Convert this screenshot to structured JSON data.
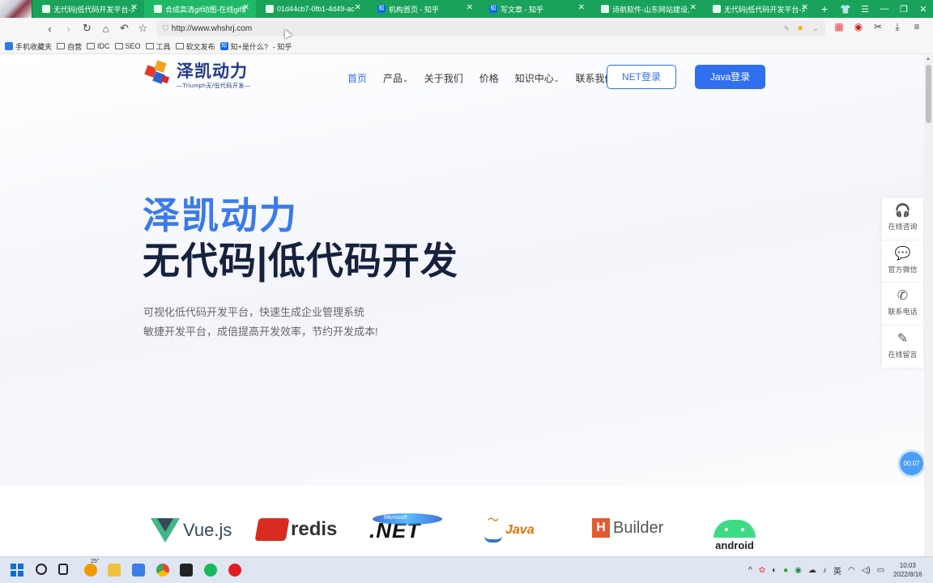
{
  "browser": {
    "tabs": [
      {
        "label": "无代码|低代码开发平台-泽",
        "icon": "leaf-icon",
        "active": false
      },
      {
        "label": "合成高清gif动图-在线gif制",
        "icon": "image-icon",
        "active": true
      },
      {
        "label": "01d44cb7-0fb1-4d49-ac",
        "icon": "file-icon",
        "active": false
      },
      {
        "label": "机构首页 - 知乎",
        "icon": "zhihu-icon",
        "active": false
      },
      {
        "label": "写文章 - 知乎",
        "icon": "zhihu-icon",
        "active": false
      },
      {
        "label": "诗航软件-山东网站建设,",
        "icon": "leaf-icon",
        "active": false
      },
      {
        "label": "无代码|低代码开发平台-泽",
        "icon": "leaf-icon",
        "active": false
      }
    ],
    "url": "http://www.whshrj.com",
    "bookmarks": [
      {
        "label": "手机收藏夹",
        "icon": "phone-icon"
      },
      {
        "label": "自营",
        "icon": "folder-icon"
      },
      {
        "label": "IDC",
        "icon": "folder-icon"
      },
      {
        "label": "SEO",
        "icon": "folder-icon"
      },
      {
        "label": "工具",
        "icon": "folder-icon"
      },
      {
        "label": "软文发布",
        "icon": "folder-icon"
      },
      {
        "label": "知+是什么?",
        "icon": "zhihu-icon"
      },
      {
        "label": "- 知乎",
        "icon": ""
      }
    ]
  },
  "site": {
    "logo_title": "泽凯动力",
    "logo_sub": "—Triumph无/低代码开发—",
    "nav": [
      {
        "label": "首页",
        "active": true,
        "dropdown": false
      },
      {
        "label": "产品",
        "active": false,
        "dropdown": true
      },
      {
        "label": "关于我们",
        "active": false,
        "dropdown": false
      },
      {
        "label": "价格",
        "active": false,
        "dropdown": false
      },
      {
        "label": "知识中心",
        "active": false,
        "dropdown": true
      },
      {
        "label": "联系我们",
        "active": false,
        "dropdown": false
      }
    ],
    "net_login": "NET登录",
    "java_login": "Java登录",
    "hero_title1": "泽凯动力",
    "hero_title2": "无代码|低代码开发",
    "hero_desc1": "可视化低代码开发平台，快速生成企业管理系统",
    "hero_desc2": "敏捷开发平台，成倍提高开发效率，节约开发成本!",
    "side": [
      {
        "label": "在线咨询",
        "icon": "headset-icon"
      },
      {
        "label": "官方微信",
        "icon": "wechat-icon"
      },
      {
        "label": "联系电话",
        "icon": "phone-icon"
      },
      {
        "label": "在线留言",
        "icon": "feather-icon"
      }
    ],
    "timer": "00:07",
    "partners": [
      "Vue.js",
      "redis",
      ".NET",
      "Java",
      "Builder",
      "android"
    ],
    "partner_extra": {
      "net_small": "Microsoft",
      "hbuilder_h": "H"
    }
  },
  "taskbar": {
    "weather": "25°",
    "tray_lang": "英",
    "time": "10:03",
    "date": "2022/8/16"
  },
  "colors": {
    "accent": "#2f6ff0",
    "tabbar": "#19a35a",
    "hero_title": "#3a7bea"
  }
}
